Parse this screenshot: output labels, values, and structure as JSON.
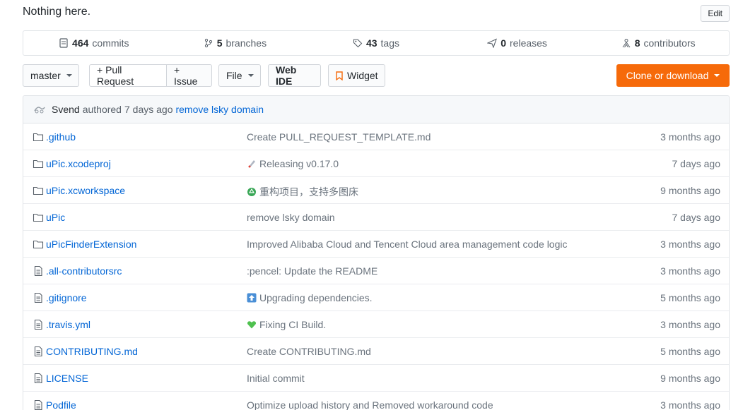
{
  "description": {
    "text": "Nothing here.",
    "edit_label": "Edit"
  },
  "summary": {
    "commits": {
      "count": "464",
      "label": "commits"
    },
    "branches": {
      "count": "5",
      "label": "branches"
    },
    "tags": {
      "count": "43",
      "label": "tags"
    },
    "releases": {
      "count": "0",
      "label": "releases"
    },
    "contributors": {
      "count": "8",
      "label": "contributors"
    }
  },
  "toolbar": {
    "branch_label": "master",
    "pull_request_label": "+ Pull Request",
    "issue_label": "+ Issue",
    "file_label": "File",
    "web_ide_label": "Web IDE",
    "widget_label": "Widget",
    "clone_label": "Clone or download"
  },
  "commit": {
    "author": "Svend",
    "verb": "authored",
    "time": "7 days ago",
    "message": "remove lsky domain"
  },
  "files": [
    {
      "type": "dir",
      "name": ".github",
      "message": "Create PULL_REQUEST_TEMPLATE.md",
      "time": "3 months ago",
      "emoji": ""
    },
    {
      "type": "dir",
      "name": "uPic.xcodeproj",
      "message": "Releasing v0.17.0",
      "time": "7 days ago",
      "emoji": "rocket"
    },
    {
      "type": "dir",
      "name": "uPic.xcworkspace",
      "message": "重构项目，支持多图床",
      "time": "9 months ago",
      "emoji": "recycle"
    },
    {
      "type": "dir",
      "name": "uPic",
      "message": "remove lsky domain",
      "time": "7 days ago",
      "emoji": ""
    },
    {
      "type": "dir",
      "name": "uPicFinderExtension",
      "message": "Improved Alibaba Cloud and Tencent Cloud area management code logic",
      "time": "3 months ago",
      "emoji": ""
    },
    {
      "type": "file",
      "name": ".all-contributorsrc",
      "message": ":pencel: Update the README",
      "time": "3 months ago",
      "emoji": ""
    },
    {
      "type": "file",
      "name": ".gitignore",
      "message": "Upgrading dependencies.",
      "time": "5 months ago",
      "emoji": "arrow-up"
    },
    {
      "type": "file",
      "name": ".travis.yml",
      "message": "Fixing CI Build.",
      "time": "3 months ago",
      "emoji": "green-heart"
    },
    {
      "type": "file",
      "name": "CONTRIBUTING.md",
      "message": "Create CONTRIBUTING.md",
      "time": "5 months ago",
      "emoji": ""
    },
    {
      "type": "file",
      "name": "LICENSE",
      "message": "Initial commit",
      "time": "9 months ago",
      "emoji": ""
    },
    {
      "type": "file",
      "name": "Podfile",
      "message": "Optimize upload history and Removed workaround code",
      "time": "3 months ago",
      "emoji": ""
    }
  ]
}
